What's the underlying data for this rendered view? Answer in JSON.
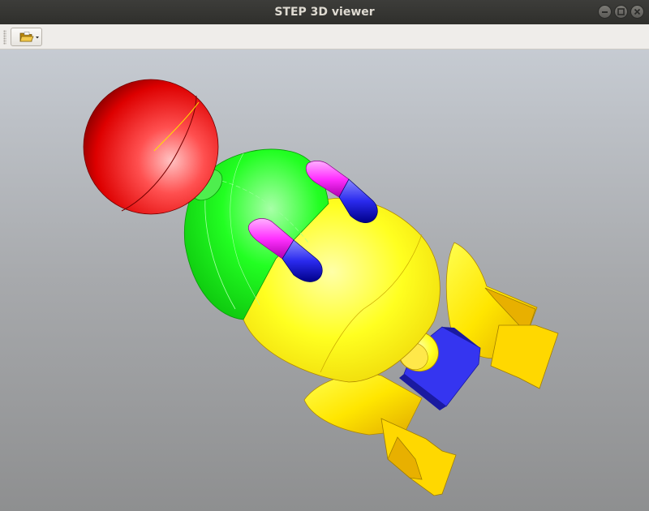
{
  "window": {
    "title": "STEP 3D viewer"
  },
  "window_controls": {
    "icons": [
      "minimize-icon",
      "maximize-icon",
      "close-icon"
    ]
  },
  "toolbar": {
    "open_button_icon": "folder-open-icon",
    "open_button_has_dropdown": true
  },
  "viewport": {
    "background_top": "#c6cbd2",
    "background_bottom": "#8e8f90",
    "model_parts": [
      {
        "name": "head-sphere",
        "color": "#e01010"
      },
      {
        "name": "neck",
        "color": "#33dd33"
      },
      {
        "name": "upper-body",
        "color": "#11ee11"
      },
      {
        "name": "lower-body",
        "color": "#ffee00"
      },
      {
        "name": "arm-left",
        "colors": [
          "#ff33ff",
          "#2a2aee"
        ]
      },
      {
        "name": "arm-right",
        "colors": [
          "#ff33ff",
          "#2a2aee"
        ]
      },
      {
        "name": "leg-right",
        "color": "#ffdd00"
      },
      {
        "name": "leg-left",
        "color": "#ffdd00"
      },
      {
        "name": "hip-connector",
        "color": "#ffdd00"
      },
      {
        "name": "blue-block",
        "color": "#3535f0"
      }
    ]
  }
}
